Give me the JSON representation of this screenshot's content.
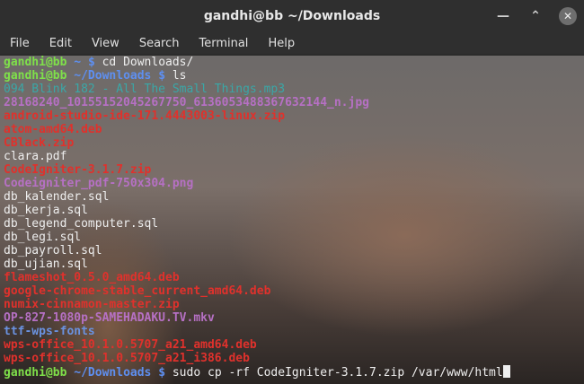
{
  "window": {
    "title": "gandhi@bb ~/Downloads",
    "controls": [
      "minimize",
      "maximize",
      "close"
    ]
  },
  "menu": [
    "File",
    "Edit",
    "View",
    "Search",
    "Terminal",
    "Help"
  ],
  "prompt": {
    "user_host": "gandhi@bb",
    "dollar": "$"
  },
  "lines": [
    {
      "kind": "prompt",
      "path": "~",
      "cmd": "cd Downloads/"
    },
    {
      "kind": "prompt",
      "path": "~/Downloads",
      "cmd": "ls"
    },
    {
      "kind": "file",
      "name": "094 Blink 182 - All The Small Things.mp3",
      "color": "cyan"
    },
    {
      "kind": "file",
      "name": "28168240_10155152045267750_6136053488367632144_n.jpg",
      "color": "magenta"
    },
    {
      "kind": "file",
      "name": "android-studio-ide-171.4443003-linux.zip",
      "color": "red"
    },
    {
      "kind": "file",
      "name": "atom-amd64.deb",
      "color": "red"
    },
    {
      "kind": "file",
      "name": "CBlack.zip",
      "color": "red"
    },
    {
      "kind": "file",
      "name": "clara.pdf",
      "color": "white"
    },
    {
      "kind": "file",
      "name": "CodeIgniter-3.1.7.zip",
      "color": "red"
    },
    {
      "kind": "file",
      "name": "Codeigniter_pdf-750x304.png",
      "color": "magenta"
    },
    {
      "kind": "file",
      "name": "db_kalender.sql",
      "color": "white"
    },
    {
      "kind": "file",
      "name": "db_kerja.sql",
      "color": "white"
    },
    {
      "kind": "file",
      "name": "db_legend_computer.sql",
      "color": "white"
    },
    {
      "kind": "file",
      "name": "db_legi.sql",
      "color": "white"
    },
    {
      "kind": "file",
      "name": "db_payroll.sql",
      "color": "white"
    },
    {
      "kind": "file",
      "name": "db_ujian.sql",
      "color": "white"
    },
    {
      "kind": "file",
      "name": "flameshot_0.5.0_amd64.deb",
      "color": "red"
    },
    {
      "kind": "file",
      "name": "google-chrome-stable_current_amd64.deb",
      "color": "red"
    },
    {
      "kind": "file",
      "name": "numix-cinnamon-master.zip",
      "color": "red"
    },
    {
      "kind": "file",
      "name": "OP-827-1080p-SAMEHADAKU.TV.mkv",
      "color": "magenta"
    },
    {
      "kind": "file",
      "name": "ttf-wps-fonts",
      "color": "bblue"
    },
    {
      "kind": "file",
      "name": "wps-office_10.1.0.5707_a21_amd64.deb",
      "color": "red"
    },
    {
      "kind": "file",
      "name": "wps-office_10.1.0.5707_a21_i386.deb",
      "color": "red"
    },
    {
      "kind": "prompt",
      "path": "~/Downloads",
      "cmd": "sudo cp -rf CodeIgniter-3.1.7.zip /var/www/html",
      "cursor": true
    }
  ],
  "colors": {
    "user_host": "#7fe04a",
    "path": "#5e8ff0",
    "cyan": "#3aa7a7",
    "magenta": "#b670c4",
    "red": "#e0312c",
    "white": "#eeeeee",
    "bblue": "#6a92e0"
  }
}
